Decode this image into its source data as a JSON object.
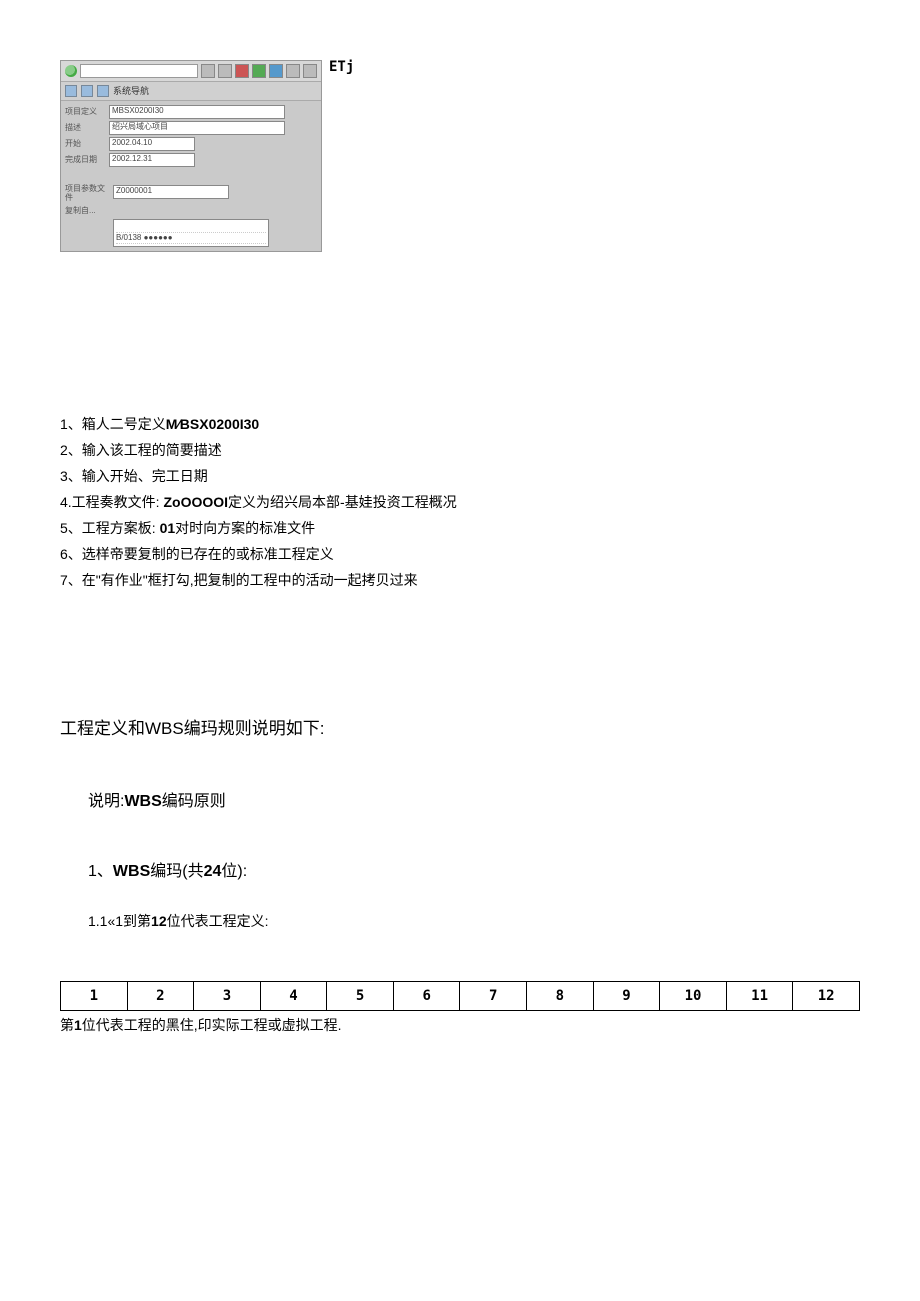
{
  "window": {
    "etj": "ETj",
    "toolbar2_text": "系统导航",
    "fields": {
      "def_label": "项目定义",
      "def_value": "MBSX0200I30",
      "desc_label": "描述",
      "desc_value": "绍兴局域心项目",
      "start_label": "开始",
      "start_value": "2002.04.10",
      "end_label": "完成日期",
      "end_value": "2002.12.31"
    },
    "lower": {
      "param_label": "项目参数文件",
      "param_value": "Z0000001",
      "copy_label": "复制自...",
      "box_line": "B/0138 ●●●●●●"
    }
  },
  "instructions": {
    "i1_pre": "1、箱人二号定义",
    "i1_code": "M∕BSX0200I30",
    "i2": "2、输入该工程的简要描述",
    "i3": "3、输入开始、完工日期",
    "i4_pre": "4.工程奏教文件:",
    "i4_code": "ZoOOOOI",
    "i4_post": "定义为绍兴局本部-基娃投资工程概况",
    "i5_pre": "5、工程方案板:",
    "i5_code": "01",
    "i5_post": "对时向方案的标准文件",
    "i6": "6、选样帝要复制的已存在的或标准工程定义",
    "i7": "7、在\"有作业\"框打勾,把复制的工程中的活动一起拷贝过来"
  },
  "sections": {
    "title": "工程定义和WBS编玛规则说明如下:",
    "sub1_pre": "说明:",
    "sub1_bold": "WBS",
    "sub1_post": "编码原则",
    "sub2_pre": "1、",
    "sub2_bold": "WBS",
    "sub2_mid": "编玛(共",
    "sub2_num": "24",
    "sub2_post": "位):",
    "sub3_pre": "1.1«1到第",
    "sub3_num": "12",
    "sub3_post": "位代表工程定义:"
  },
  "table": {
    "cells": [
      "1",
      "2",
      "3",
      "4",
      "5",
      "6",
      "7",
      "8",
      "9",
      "10",
      "11",
      "12"
    ]
  },
  "footnote": {
    "pre": "第",
    "num": "1",
    "post": "位代表工程的黑住,印实际工程或虚拟工程."
  }
}
